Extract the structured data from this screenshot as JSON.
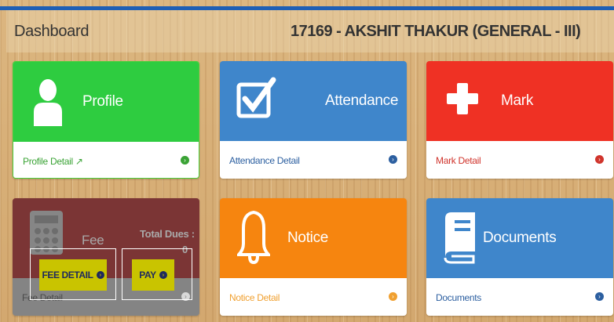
{
  "header": {
    "title": "Dashboard",
    "student": "17169 - AKSHIT THAKUR (GENERAL - III)"
  },
  "cards": {
    "profile": {
      "title": "Profile",
      "link": "Profile Detail",
      "link_color": "#3aa335"
    },
    "attendance": {
      "title": "Attendance",
      "link": "Attendance Detail",
      "link_color": "#2c5fa0"
    },
    "mark": {
      "title": "Mark",
      "link": "Mark Detail",
      "link_color": "#d0342c"
    },
    "fee": {
      "title": "Fee",
      "dues_label": "Total Dues :",
      "dues_value": "0",
      "link": "Fee Detail",
      "fee_detail_button": "FEE DETAIL",
      "pay_button": "PAY"
    },
    "notice": {
      "title": "Notice",
      "link": "Notice Detail",
      "link_color": "#f0a030"
    },
    "documents": {
      "title": "Documents",
      "link": "Documents",
      "link_color": "#2c5fa0"
    }
  },
  "colors": {
    "profile": "#2ecc40",
    "attendance": "#3f86cb",
    "mark": "#ef3124",
    "fee": "#7d1d1d",
    "notice": "#f6850f",
    "documents": "#3f86cb",
    "accent_bar": "#1f5fb5"
  }
}
